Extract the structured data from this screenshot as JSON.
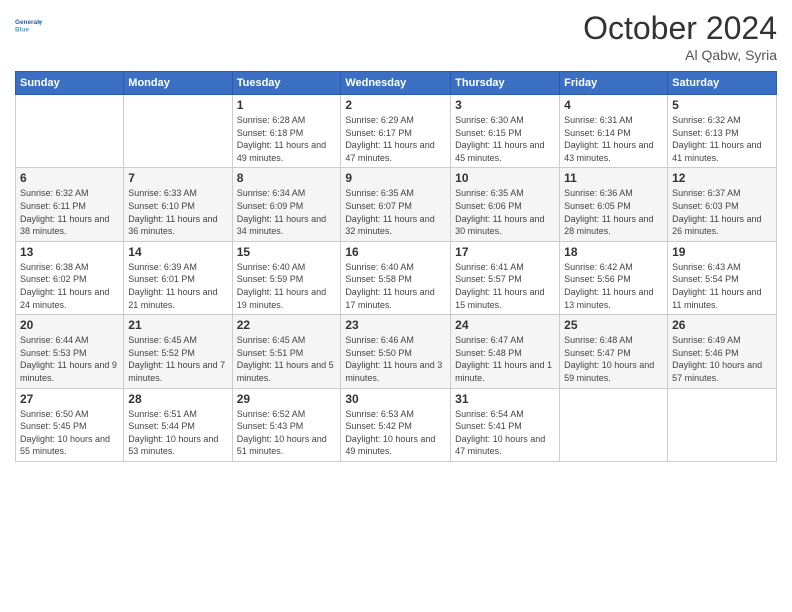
{
  "header": {
    "logo_line1": "General",
    "logo_line2": "Blue",
    "month_title": "October 2024",
    "location": "Al Qabw, Syria"
  },
  "weekdays": [
    "Sunday",
    "Monday",
    "Tuesday",
    "Wednesday",
    "Thursday",
    "Friday",
    "Saturday"
  ],
  "weeks": [
    [
      {
        "day": "",
        "info": ""
      },
      {
        "day": "",
        "info": ""
      },
      {
        "day": "1",
        "info": "Sunrise: 6:28 AM\nSunset: 6:18 PM\nDaylight: 11 hours and 49 minutes."
      },
      {
        "day": "2",
        "info": "Sunrise: 6:29 AM\nSunset: 6:17 PM\nDaylight: 11 hours and 47 minutes."
      },
      {
        "day": "3",
        "info": "Sunrise: 6:30 AM\nSunset: 6:15 PM\nDaylight: 11 hours and 45 minutes."
      },
      {
        "day": "4",
        "info": "Sunrise: 6:31 AM\nSunset: 6:14 PM\nDaylight: 11 hours and 43 minutes."
      },
      {
        "day": "5",
        "info": "Sunrise: 6:32 AM\nSunset: 6:13 PM\nDaylight: 11 hours and 41 minutes."
      }
    ],
    [
      {
        "day": "6",
        "info": "Sunrise: 6:32 AM\nSunset: 6:11 PM\nDaylight: 11 hours and 38 minutes."
      },
      {
        "day": "7",
        "info": "Sunrise: 6:33 AM\nSunset: 6:10 PM\nDaylight: 11 hours and 36 minutes."
      },
      {
        "day": "8",
        "info": "Sunrise: 6:34 AM\nSunset: 6:09 PM\nDaylight: 11 hours and 34 minutes."
      },
      {
        "day": "9",
        "info": "Sunrise: 6:35 AM\nSunset: 6:07 PM\nDaylight: 11 hours and 32 minutes."
      },
      {
        "day": "10",
        "info": "Sunrise: 6:35 AM\nSunset: 6:06 PM\nDaylight: 11 hours and 30 minutes."
      },
      {
        "day": "11",
        "info": "Sunrise: 6:36 AM\nSunset: 6:05 PM\nDaylight: 11 hours and 28 minutes."
      },
      {
        "day": "12",
        "info": "Sunrise: 6:37 AM\nSunset: 6:03 PM\nDaylight: 11 hours and 26 minutes."
      }
    ],
    [
      {
        "day": "13",
        "info": "Sunrise: 6:38 AM\nSunset: 6:02 PM\nDaylight: 11 hours and 24 minutes."
      },
      {
        "day": "14",
        "info": "Sunrise: 6:39 AM\nSunset: 6:01 PM\nDaylight: 11 hours and 21 minutes."
      },
      {
        "day": "15",
        "info": "Sunrise: 6:40 AM\nSunset: 5:59 PM\nDaylight: 11 hours and 19 minutes."
      },
      {
        "day": "16",
        "info": "Sunrise: 6:40 AM\nSunset: 5:58 PM\nDaylight: 11 hours and 17 minutes."
      },
      {
        "day": "17",
        "info": "Sunrise: 6:41 AM\nSunset: 5:57 PM\nDaylight: 11 hours and 15 minutes."
      },
      {
        "day": "18",
        "info": "Sunrise: 6:42 AM\nSunset: 5:56 PM\nDaylight: 11 hours and 13 minutes."
      },
      {
        "day": "19",
        "info": "Sunrise: 6:43 AM\nSunset: 5:54 PM\nDaylight: 11 hours and 11 minutes."
      }
    ],
    [
      {
        "day": "20",
        "info": "Sunrise: 6:44 AM\nSunset: 5:53 PM\nDaylight: 11 hours and 9 minutes."
      },
      {
        "day": "21",
        "info": "Sunrise: 6:45 AM\nSunset: 5:52 PM\nDaylight: 11 hours and 7 minutes."
      },
      {
        "day": "22",
        "info": "Sunrise: 6:45 AM\nSunset: 5:51 PM\nDaylight: 11 hours and 5 minutes."
      },
      {
        "day": "23",
        "info": "Sunrise: 6:46 AM\nSunset: 5:50 PM\nDaylight: 11 hours and 3 minutes."
      },
      {
        "day": "24",
        "info": "Sunrise: 6:47 AM\nSunset: 5:48 PM\nDaylight: 11 hours and 1 minute."
      },
      {
        "day": "25",
        "info": "Sunrise: 6:48 AM\nSunset: 5:47 PM\nDaylight: 10 hours and 59 minutes."
      },
      {
        "day": "26",
        "info": "Sunrise: 6:49 AM\nSunset: 5:46 PM\nDaylight: 10 hours and 57 minutes."
      }
    ],
    [
      {
        "day": "27",
        "info": "Sunrise: 6:50 AM\nSunset: 5:45 PM\nDaylight: 10 hours and 55 minutes."
      },
      {
        "day": "28",
        "info": "Sunrise: 6:51 AM\nSunset: 5:44 PM\nDaylight: 10 hours and 53 minutes."
      },
      {
        "day": "29",
        "info": "Sunrise: 6:52 AM\nSunset: 5:43 PM\nDaylight: 10 hours and 51 minutes."
      },
      {
        "day": "30",
        "info": "Sunrise: 6:53 AM\nSunset: 5:42 PM\nDaylight: 10 hours and 49 minutes."
      },
      {
        "day": "31",
        "info": "Sunrise: 6:54 AM\nSunset: 5:41 PM\nDaylight: 10 hours and 47 minutes."
      },
      {
        "day": "",
        "info": ""
      },
      {
        "day": "",
        "info": ""
      }
    ]
  ]
}
